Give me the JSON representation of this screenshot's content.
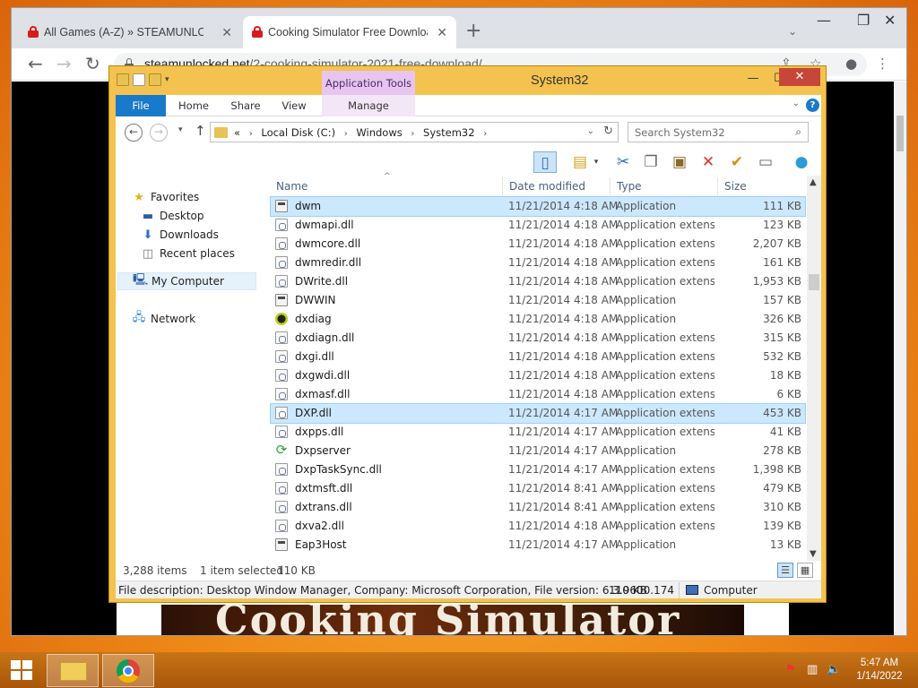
{
  "browser": {
    "tabs": [
      {
        "title": "All Games (A-Z) » STEAMUNLOCKED",
        "active": false
      },
      {
        "title": "Cooking Simulator Free Download",
        "active": true
      }
    ],
    "new_tab": "+",
    "url": {
      "host": "steamunlocked.net",
      "path": "/2-cooking-simulator-2021-free-download/"
    },
    "page_banner": "Cooking Simulator"
  },
  "explorer": {
    "title": "System32",
    "contextual_tab": "Application Tools",
    "ribbon_tabs": {
      "file": "File",
      "home": "Home",
      "share": "Share",
      "view": "View",
      "manage": "Manage"
    },
    "breadcrumb": {
      "prefix": "«",
      "items": [
        "Local Disk (C:)",
        "Windows",
        "System32"
      ]
    },
    "search_placeholder": "Search System32",
    "nav": {
      "favorites": "Favorites",
      "desktop": "Desktop",
      "downloads": "Downloads",
      "recent": "Recent places",
      "computer": "My Computer",
      "network": "Network"
    },
    "columns": {
      "name": "Name",
      "date": "Date modified",
      "type": "Type",
      "size": "Size"
    },
    "files": [
      {
        "name": "dwm",
        "date": "11/21/2014 4:18 AM",
        "type": "Application",
        "size": "111 KB",
        "icon": "app",
        "selected": true
      },
      {
        "name": "dwmapi.dll",
        "date": "11/21/2014 4:18 AM",
        "type": "Application extens...",
        "size": "123 KB",
        "icon": "dll"
      },
      {
        "name": "dwmcore.dll",
        "date": "11/21/2014 4:18 AM",
        "type": "Application extens...",
        "size": "2,207 KB",
        "icon": "dll"
      },
      {
        "name": "dwmredir.dll",
        "date": "11/21/2014 4:18 AM",
        "type": "Application extens...",
        "size": "161 KB",
        "icon": "dll"
      },
      {
        "name": "DWrite.dll",
        "date": "11/21/2014 4:18 AM",
        "type": "Application extens...",
        "size": "1,953 KB",
        "icon": "dll"
      },
      {
        "name": "DWWIN",
        "date": "11/21/2014 4:18 AM",
        "type": "Application",
        "size": "157 KB",
        "icon": "app"
      },
      {
        "name": "dxdiag",
        "date": "11/21/2014 4:18 AM",
        "type": "Application",
        "size": "326 KB",
        "icon": "xbox"
      },
      {
        "name": "dxdiagn.dll",
        "date": "11/21/2014 4:18 AM",
        "type": "Application extens...",
        "size": "315 KB",
        "icon": "dll"
      },
      {
        "name": "dxgi.dll",
        "date": "11/21/2014 4:18 AM",
        "type": "Application extens...",
        "size": "532 KB",
        "icon": "dll"
      },
      {
        "name": "dxgwdi.dll",
        "date": "11/21/2014 4:18 AM",
        "type": "Application extens...",
        "size": "18 KB",
        "icon": "dll"
      },
      {
        "name": "dxmasf.dll",
        "date": "11/21/2014 4:18 AM",
        "type": "Application extens...",
        "size": "6 KB",
        "icon": "dll"
      },
      {
        "name": "DXP.dll",
        "date": "11/21/2014 4:17 AM",
        "type": "Application extens...",
        "size": "453 KB",
        "icon": "dll",
        "hover": true
      },
      {
        "name": "dxpps.dll",
        "date": "11/21/2014 4:17 AM",
        "type": "Application extens...",
        "size": "41 KB",
        "icon": "dll"
      },
      {
        "name": "Dxpserver",
        "date": "11/21/2014 4:17 AM",
        "type": "Application",
        "size": "278 KB",
        "icon": "sync"
      },
      {
        "name": "DxpTaskSync.dll",
        "date": "11/21/2014 4:17 AM",
        "type": "Application extens...",
        "size": "1,398 KB",
        "icon": "dll"
      },
      {
        "name": "dxtmsft.dll",
        "date": "11/21/2014 8:41 AM",
        "type": "Application extens...",
        "size": "479 KB",
        "icon": "dll"
      },
      {
        "name": "dxtrans.dll",
        "date": "11/21/2014 8:41 AM",
        "type": "Application extens...",
        "size": "310 KB",
        "icon": "dll"
      },
      {
        "name": "dxva2.dll",
        "date": "11/21/2014 4:18 AM",
        "type": "Application extens...",
        "size": "139 KB",
        "icon": "dll"
      },
      {
        "name": "Eap3Host",
        "date": "11/21/2014 4:17 AM",
        "type": "Application",
        "size": "13 KB",
        "icon": "app"
      }
    ],
    "status": {
      "count": "3,288 items",
      "selected": "1 item selected",
      "selected_size": "110 KB"
    },
    "details": {
      "description": "File description: Desktop Window Manager, Company: Microsoft Corporation, File version: 6.3.9600.174",
      "size": "110 KB",
      "location": "Computer"
    }
  },
  "taskbar": {
    "time": "5:47 AM",
    "date": "1/14/2022"
  },
  "colors": {
    "accent": "#1979ca",
    "explorer_frame": "#f4c34f",
    "desktop": "#ef8a17"
  }
}
